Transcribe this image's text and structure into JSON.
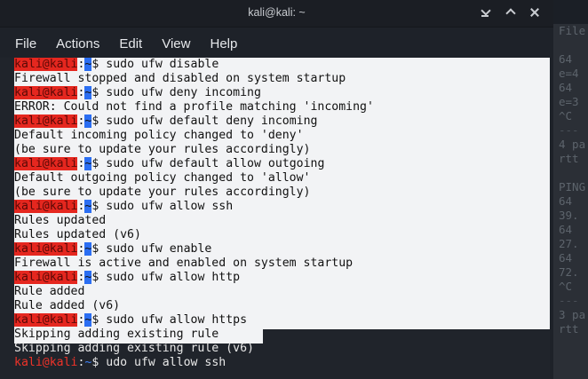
{
  "window": {
    "title": "kali@kali: ~"
  },
  "menu": [
    "File",
    "Actions",
    "Edit",
    "View",
    "Help"
  ],
  "prompt": {
    "user": "kali@kali",
    "colon": ":",
    "path": "~",
    "symbol": "$ "
  },
  "lines": [
    {
      "type": "cmd",
      "text": "sudo ufw disable"
    },
    {
      "type": "out",
      "text": "Firewall stopped and disabled on system startup"
    },
    {
      "type": "cmd",
      "text": "sudo ufw deny incoming"
    },
    {
      "type": "out",
      "text": "ERROR: Could not find a profile matching 'incoming'"
    },
    {
      "type": "cmd",
      "text": "sudo ufw default deny incoming"
    },
    {
      "type": "out",
      "text": "Default incoming policy changed to 'deny'"
    },
    {
      "type": "out",
      "text": "(be sure to update your rules accordingly)"
    },
    {
      "type": "cmd",
      "text": "sudo ufw default allow outgoing"
    },
    {
      "type": "out",
      "text": "Default outgoing policy changed to 'allow'"
    },
    {
      "type": "out",
      "text": "(be sure to update your rules accordingly)"
    },
    {
      "type": "cmd",
      "text": "sudo ufw allow ssh"
    },
    {
      "type": "out",
      "text": "Rules updated"
    },
    {
      "type": "out",
      "text": "Rules updated (v6)"
    },
    {
      "type": "cmd",
      "text": "sudo ufw enable"
    },
    {
      "type": "out",
      "text": "Firewall is active and enabled on system startup"
    },
    {
      "type": "cmd",
      "text": "sudo ufw allow http"
    },
    {
      "type": "out",
      "text": "Rule added"
    },
    {
      "type": "out",
      "text": "Rule added (v6)"
    },
    {
      "type": "cmd",
      "text": "sudo ufw allow https"
    },
    {
      "type": "out",
      "text": "Skipping adding existing rule"
    },
    {
      "type": "out",
      "text": "Skipping adding existing rule (v6)",
      "dark": true
    },
    {
      "type": "cmd",
      "text": "udo ufw allow ssh",
      "dark": true
    }
  ],
  "background_terminal": {
    "lines": [
      "File",
      "",
      "64 ",
      "e=4",
      "64 ",
      "e=3",
      "^C",
      "---",
      "4 pa",
      "rtt",
      "",
      "PING",
      "64 ",
      "39.",
      "64 ",
      "27.",
      "64 ",
      "72.",
      "^C",
      "---",
      "3 pa",
      "rtt"
    ]
  },
  "colors": {
    "selection": "#f2f3f5",
    "user_red": "#e5271f",
    "path_blue": "#2b6ef2",
    "terminal_bg": "#20242b"
  }
}
